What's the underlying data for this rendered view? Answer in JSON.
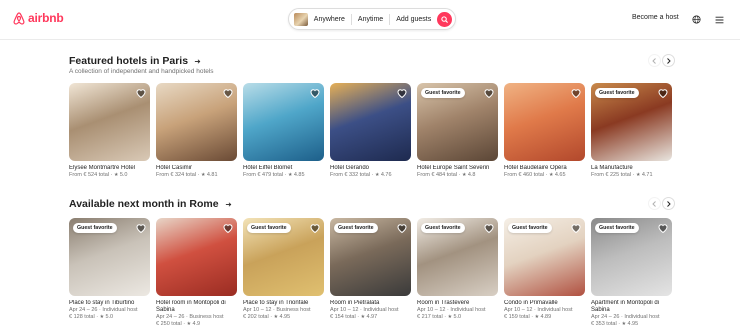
{
  "header": {
    "logo_text": "airbnb",
    "search": {
      "anywhere": "Anywhere",
      "anytime": "Anytime",
      "add_guests": "Add guests"
    },
    "become_host": "Become a host",
    "globe_icon": "globe-icon",
    "menu_icon": "hamburger-menu-icon",
    "brand_color": "#ff385c"
  },
  "sections": [
    {
      "title": "Featured hotels in Paris",
      "subtitle": "A collection of independent and handpicked hotels",
      "cards": [
        {
          "title": "Elysee Montmartre Hotel",
          "meta": "",
          "price": "From € 524 total",
          "rating": "5.0",
          "badge": "",
          "colors": [
            "#d9c9b6",
            "#a98f72",
            "#f1e6d6"
          ]
        },
        {
          "title": "Hôtel Casimir",
          "meta": "",
          "price": "From € 324 total",
          "rating": "4.81",
          "badge": "",
          "colors": [
            "#6a4a35",
            "#c8a27a",
            "#e8d9c4"
          ]
        },
        {
          "title": "Hôtel Eiffel Blomet",
          "meta": "",
          "price": "From € 479 total",
          "rating": "4.85",
          "badge": "",
          "colors": [
            "#1d5f8a",
            "#4fa6c9",
            "#b9dde8"
          ]
        },
        {
          "title": "Hotel Gérando",
          "meta": "",
          "price": "From € 332 total",
          "rating": "4.76",
          "badge": "",
          "colors": [
            "#1e2a4f",
            "#3c4f86",
            "#e6b057"
          ]
        },
        {
          "title": "Hotel Europe Saint Severin",
          "meta": "",
          "price": "From € 484 total",
          "rating": "4.8",
          "badge": "Guest favorite",
          "colors": [
            "#5b4636",
            "#a0836a",
            "#d8c4aa"
          ]
        },
        {
          "title": "Hôtel Baudelaire Opéra",
          "meta": "",
          "price": "From € 460 total",
          "rating": "4.65",
          "badge": "",
          "colors": [
            "#b2482c",
            "#e07a4a",
            "#f0b384"
          ]
        },
        {
          "title": "La Manufacture",
          "meta": "",
          "price": "From € 225 total",
          "rating": "4.71",
          "badge": "Guest favorite",
          "colors": [
            "#e9e6e0",
            "#8a3a22",
            "#c98a4b"
          ]
        }
      ]
    },
    {
      "title": "Available next month in Rome",
      "subtitle": "",
      "cards": [
        {
          "title": "Place to stay in Tiburtino",
          "meta": "Apr 24 – 26 · Individual host",
          "price": "€ 128 total",
          "rating": "5.0",
          "badge": "Guest favorite",
          "colors": [
            "#ece8e2",
            "#c9c2b8",
            "#8a7e70"
          ]
        },
        {
          "title": "Hotel room in Montopoli di Sabina",
          "meta": "Apr 24 – 26 · Business host",
          "price": "€ 250 total",
          "rating": "4.9",
          "badge": "",
          "colors": [
            "#9a2c22",
            "#d05040",
            "#e8d6c8"
          ]
        },
        {
          "title": "Place to stay in Trionfale",
          "meta": "Apr 10 – 12 · Business host",
          "price": "€ 202 total",
          "rating": "4.95",
          "badge": "Guest favorite",
          "colors": [
            "#e0c070",
            "#c9a25a",
            "#f3e3b8"
          ]
        },
        {
          "title": "Room in Pietralata",
          "meta": "Apr 10 – 12 · Individual host",
          "price": "€ 154 total",
          "rating": "4.97",
          "badge": "Guest favorite",
          "colors": [
            "#3a3a3a",
            "#7a6a5a",
            "#c9b8a2"
          ]
        },
        {
          "title": "Room in Trastevere",
          "meta": "Apr 10 – 12 · Individual host",
          "price": "€ 217 total",
          "rating": "5.0",
          "badge": "Guest favorite",
          "colors": [
            "#d8cfc4",
            "#a29280",
            "#f2ede6"
          ]
        },
        {
          "title": "Condo in Primavalle",
          "meta": "Apr 10 – 12 · Individual host",
          "price": "€ 159 total",
          "rating": "4.89",
          "badge": "Guest favorite",
          "colors": [
            "#b05040",
            "#e3d2c0",
            "#f5efe6"
          ]
        },
        {
          "title": "Apartment in Montopoli di Sabina",
          "meta": "Apr 24 – 26 · Individual host",
          "price": "€ 353 total",
          "rating": "4.95",
          "badge": "Guest favorite",
          "colors": [
            "#e4e4e4",
            "#bdbdbd",
            "#8a8a8a"
          ]
        }
      ]
    }
  ]
}
